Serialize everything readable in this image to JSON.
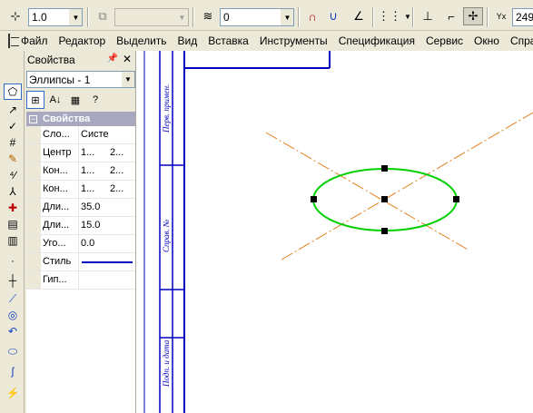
{
  "toolbar": {
    "line_step": "1.0",
    "disabled_combo": "",
    "layer": "0",
    "coord_label": "Y",
    "coord_value": "249"
  },
  "menu": {
    "items": [
      "Файл",
      "Редактор",
      "Выделить",
      "Вид",
      "Вставка",
      "Инструменты",
      "Спецификация",
      "Сервис",
      "Окно",
      "Справ"
    ]
  },
  "props": {
    "title": "Свойства",
    "object": "Эллипсы - 1",
    "section": "Свойства",
    "rows": [
      {
        "name": "Сло...",
        "v1": "Систем...",
        "v2": ""
      },
      {
        "name": "Центр",
        "v1": "1...",
        "v2": "2..."
      },
      {
        "name": "Кон...",
        "v1": "1...",
        "v2": "2..."
      },
      {
        "name": "Кон...",
        "v1": "1...",
        "v2": "2..."
      },
      {
        "name": "Дли...",
        "v1": "35.0",
        "v2": ""
      },
      {
        "name": "Дли...",
        "v1": "15.0",
        "v2": ""
      },
      {
        "name": "Уго...",
        "v1": "0.0",
        "v2": ""
      },
      {
        "name": "Стиль",
        "v1": "",
        "v2": ""
      },
      {
        "name": "Гип...",
        "v1": "",
        "v2": ""
      }
    ]
  },
  "drawing": {
    "stamp_labels": [
      "Перв. примен.",
      "Справ. №",
      "Подп. и дата"
    ],
    "colors": {
      "frame": "#0000c0",
      "ellipse": "#00d000",
      "axes": "#e08020",
      "handles": "#000000"
    }
  }
}
